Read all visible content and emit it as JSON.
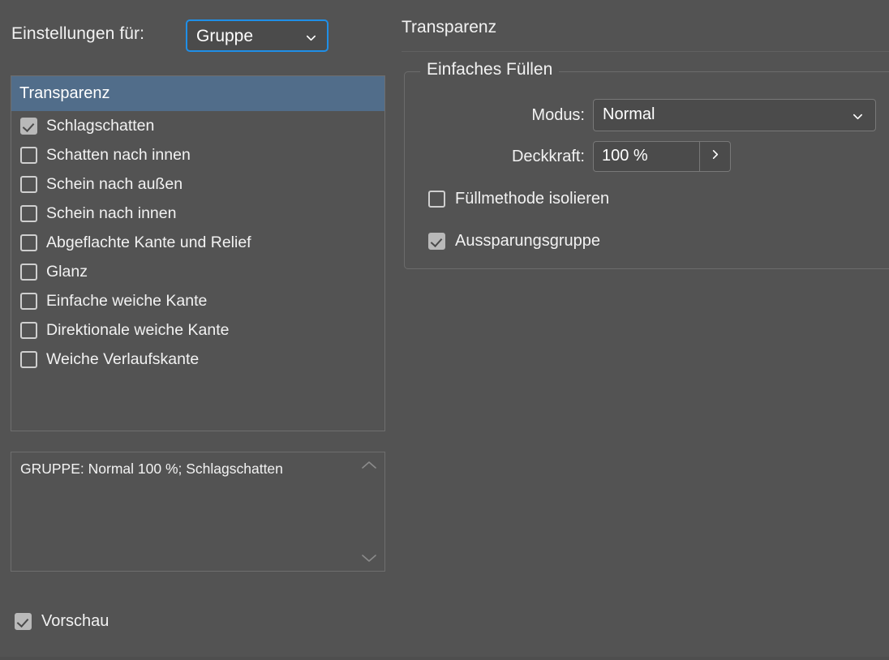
{
  "header": {
    "settings_for_label": "Einstellungen für:",
    "target_select": {
      "value": "Gruppe",
      "icon": "chevron-down-icon"
    }
  },
  "effects_panel": {
    "section_title": "Transparenz",
    "items": [
      {
        "label": "Schlagschatten",
        "checked": true
      },
      {
        "label": "Schatten nach innen",
        "checked": false
      },
      {
        "label": "Schein nach außen",
        "checked": false
      },
      {
        "label": "Schein nach innen",
        "checked": false
      },
      {
        "label": "Abgeflachte Kante und Relief",
        "checked": false
      },
      {
        "label": "Glanz",
        "checked": false
      },
      {
        "label": "Einfache weiche Kante",
        "checked": false
      },
      {
        "label": "Direktionale weiche Kante",
        "checked": false
      },
      {
        "label": "Weiche Verlaufskante",
        "checked": false
      }
    ]
  },
  "summary": {
    "text": "GRUPPE: Normal 100 %; Schlagschatten",
    "scroll_up_icon": "chevron-up-icon",
    "scroll_down_icon": "chevron-down-icon"
  },
  "preview": {
    "label": "Vorschau",
    "checked": true
  },
  "right_pane": {
    "title": "Transparenz",
    "fill_group": {
      "legend": "Einfaches Füllen",
      "mode": {
        "label": "Modus:",
        "value": "Normal",
        "icon": "chevron-down-icon"
      },
      "opacity": {
        "label": "Deckkraft:",
        "value": "100 %",
        "stepper_icon": "chevron-right-icon"
      },
      "checkboxes": [
        {
          "label": "Füllmethode isolieren",
          "checked": false
        },
        {
          "label": "Aussparungsgruppe",
          "checked": true
        }
      ]
    }
  },
  "colors": {
    "background": "#535353",
    "panel_border": "#6e6e6e",
    "selection_header": "#516D8A",
    "focus_ring": "#1F8FE8",
    "control_fill": "#4B4B4B",
    "control_border": "#787878",
    "checkbox_on": "#B9B9B9",
    "text": "#F2F2F2"
  }
}
